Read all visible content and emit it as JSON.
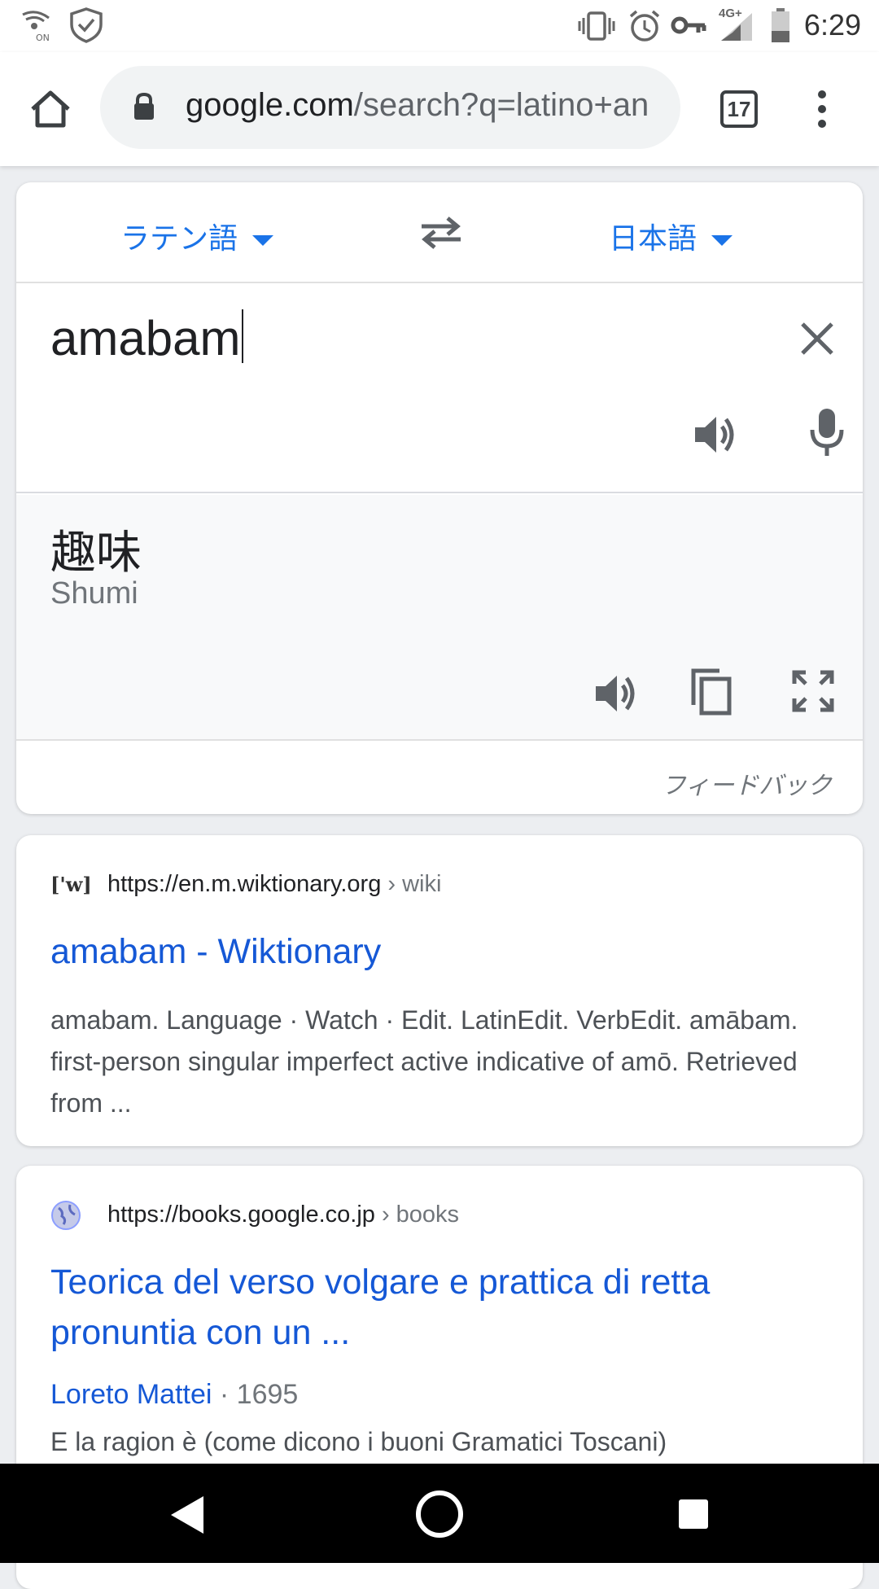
{
  "status_bar": {
    "time": "6:29",
    "network_label": "4G+"
  },
  "browser": {
    "url_domain": "google.com",
    "url_rest": "/search?q=latino+an",
    "tab_count": "17"
  },
  "translator": {
    "source_language": "ラテン語",
    "target_language": "日本語",
    "input_text": "amabam",
    "output_text": "趣味",
    "output_romanization": "Shumi",
    "feedback_label": "フィードバック"
  },
  "results": [
    {
      "favicon_text": "['w]",
      "url": "https://en.m.wiktionary.org",
      "crumb": "› wiki",
      "title": "amabam - Wiktionary",
      "snippet": "amabam. Language · Watch · Edit. LatinEdit. VerbEdit. amābam. first-person singular imperfect active indicative of amō. Retrieved from ..."
    },
    {
      "url": "https://books.google.co.jp",
      "crumb": "› books",
      "title": "Teorica del verso volgare e prattica di retta pronuntia con un ...",
      "author": "Loreto Mattei",
      "year": "· 1695",
      "snippet": "E la ragion è (come dicono i buoni Gramatici Toscani)"
    }
  ],
  "colors": {
    "link_blue": "#1558d6",
    "accent_blue": "#1a73e8"
  }
}
